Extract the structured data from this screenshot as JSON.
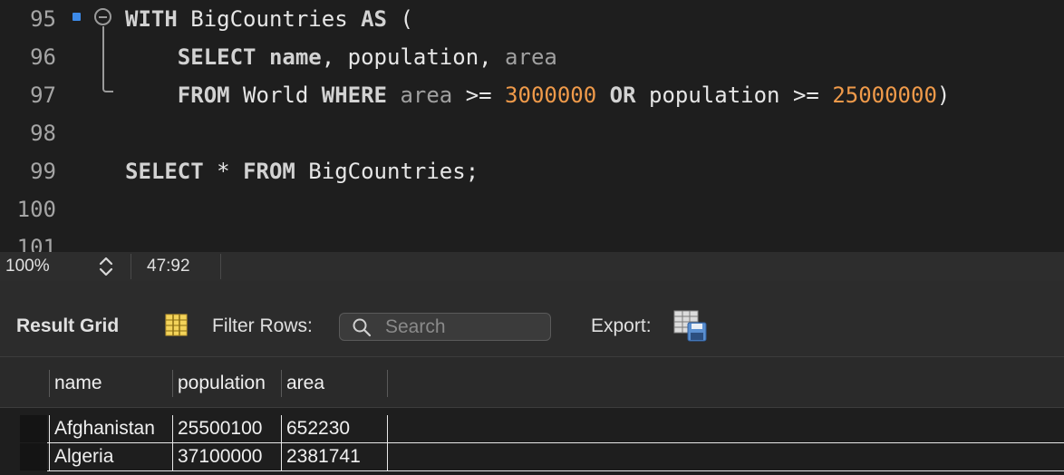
{
  "editor": {
    "lines": [
      {
        "num": "95",
        "tokens": [
          {
            "t": "WITH",
            "c": "kw"
          },
          {
            "t": " BigCountries ",
            "c": "txt"
          },
          {
            "t": "AS",
            "c": "kw"
          },
          {
            "t": " (",
            "c": "txt"
          }
        ]
      },
      {
        "num": "96",
        "tokens": [
          {
            "t": "    ",
            "c": "txt"
          },
          {
            "t": "SELECT",
            "c": "kw"
          },
          {
            "t": " ",
            "c": "txt"
          },
          {
            "t": "name",
            "c": "kw"
          },
          {
            "t": ", population, ",
            "c": "txt"
          },
          {
            "t": "area",
            "c": "col"
          }
        ]
      },
      {
        "num": "97",
        "tokens": [
          {
            "t": "    ",
            "c": "txt"
          },
          {
            "t": "FROM",
            "c": "kw"
          },
          {
            "t": " World ",
            "c": "txt"
          },
          {
            "t": "WHERE",
            "c": "kw"
          },
          {
            "t": " ",
            "c": "txt"
          },
          {
            "t": "area",
            "c": "col"
          },
          {
            "t": " >= ",
            "c": "txt"
          },
          {
            "t": "3000000",
            "c": "num"
          },
          {
            "t": " ",
            "c": "txt"
          },
          {
            "t": "OR",
            "c": "kw"
          },
          {
            "t": " population >= ",
            "c": "txt"
          },
          {
            "t": "25000000",
            "c": "num"
          },
          {
            "t": ")",
            "c": "txt"
          }
        ]
      },
      {
        "num": "98",
        "tokens": []
      },
      {
        "num": "99",
        "tokens": [
          {
            "t": "SELECT",
            "c": "kw"
          },
          {
            "t": " * ",
            "c": "txt"
          },
          {
            "t": "FROM",
            "c": "kw"
          },
          {
            "t": " BigCountries;",
            "c": "txt"
          }
        ]
      },
      {
        "num": "100",
        "tokens": []
      },
      {
        "num": "101",
        "tokens": []
      }
    ]
  },
  "statusbar": {
    "zoom": "100%",
    "cursor": "47:92"
  },
  "toolbar": {
    "result_grid_label": "Result Grid",
    "filter_label": "Filter Rows:",
    "search_placeholder": "Search",
    "export_label": "Export:"
  },
  "grid": {
    "columns": [
      "name",
      "population",
      "area"
    ],
    "rows": [
      [
        "Afghanistan",
        "25500100",
        "652230"
      ],
      [
        "Algeria",
        "37100000",
        "2381741"
      ]
    ]
  },
  "colors": {
    "keyword": "#d2d2d2",
    "number": "#ef9a4a",
    "column": "#a0a0a0",
    "breakpoint": "#3d8ae8"
  }
}
